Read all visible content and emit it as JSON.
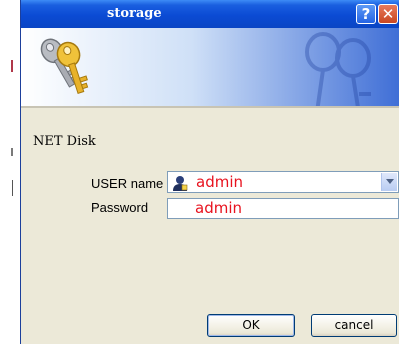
{
  "window": {
    "title": "storage",
    "help_glyph": "?",
    "close_glyph": "✕"
  },
  "form": {
    "section_label": "NET Disk",
    "user_label": "USER name",
    "user_value": "admin",
    "password_label": "Password",
    "password_value": "admin"
  },
  "buttons": {
    "ok_label": "OK",
    "cancel_label": "cancel"
  },
  "colors": {
    "titlebar": "#0b4bd4",
    "value_text": "#e8121e",
    "dialog_bg": "#ece9d8"
  },
  "icons": {
    "banner": "keys-icon",
    "watermark": "keys-watermark-icon",
    "user": "user-icon",
    "dropdown": "chevron-down-icon"
  }
}
